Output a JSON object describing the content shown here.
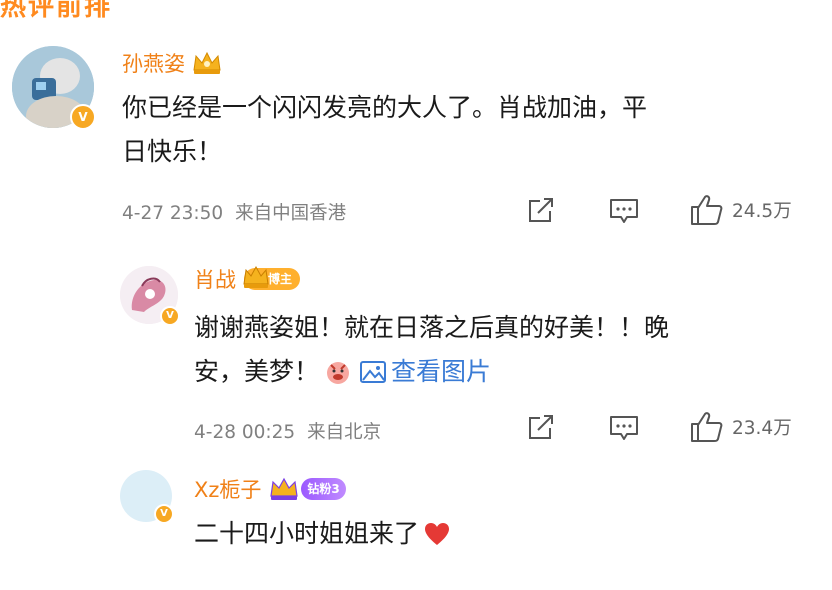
{
  "top_partial_text": "热评前排",
  "comments": [
    {
      "username": "孙燕姿",
      "text_line1": "你已经是一个闪闪发亮的大人了。肖战加油，平",
      "text_line2": "日快乐！",
      "date": "4-27 23:50",
      "location": "来自中国香港",
      "likes": "24.5万"
    },
    {
      "username": "肖战",
      "badge": "博主",
      "text_line1": "谢谢燕姿姐！就在日落之后真的好美！！晚",
      "text_line2": "安，美梦！",
      "image_link": "查看图片",
      "date": "4-28 00:25",
      "location": "来自北京",
      "likes": "23.4万"
    },
    {
      "username": "Xz栀子",
      "fan_badge": "钻粉3",
      "text": "二十四小时姐姐来了"
    }
  ],
  "verified_mark": "V",
  "icons": [
    "share-icon",
    "comment-icon",
    "like-icon",
    "crown-icon",
    "emoji-icon",
    "image-icon",
    "heart-icon"
  ]
}
